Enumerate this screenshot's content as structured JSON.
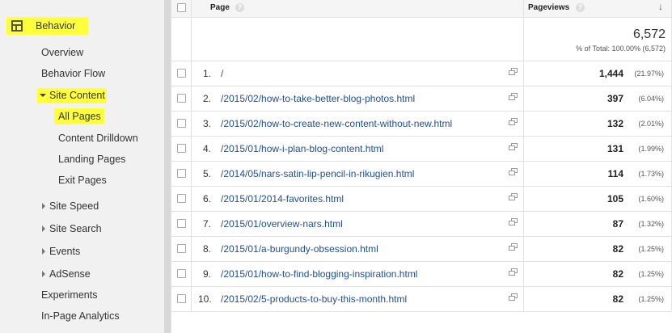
{
  "sidebar": {
    "behavior": "Behavior",
    "overview": "Overview",
    "behavior_flow": "Behavior Flow",
    "site_content": "Site Content",
    "all_pages": "All Pages",
    "content_drilldown": "Content Drilldown",
    "landing_pages": "Landing Pages",
    "exit_pages": "Exit Pages",
    "site_speed": "Site Speed",
    "site_search": "Site Search",
    "events": "Events",
    "adsense": "AdSense",
    "experiments": "Experiments",
    "in_page_analytics": "In-Page Analytics"
  },
  "colors": {
    "highlight": "#ffff3b",
    "link": "#1f4e9c"
  },
  "table": {
    "columns": {
      "page": "Page",
      "pageviews": "Pageviews"
    },
    "help_glyph": "?",
    "sort_glyph": "↓",
    "total": {
      "value": "6,572",
      "subtext": "% of Total: 100.00% (6,572)"
    },
    "rows": [
      {
        "rank": "1.",
        "page": "/",
        "pageviews": "1,444",
        "pct": "(21.97%)"
      },
      {
        "rank": "2.",
        "page": "/2015/02/how-to-take-better-blog-photos.html",
        "pageviews": "397",
        "pct": "(6.04%)"
      },
      {
        "rank": "3.",
        "page": "/2015/02/how-to-create-new-content-without-new.html",
        "pageviews": "132",
        "pct": "(2.01%)"
      },
      {
        "rank": "4.",
        "page": "/2015/01/how-i-plan-blog-content.html",
        "pageviews": "131",
        "pct": "(1.99%)"
      },
      {
        "rank": "5.",
        "page": "/2014/05/nars-satin-lip-pencil-in-rikugien.html",
        "pageviews": "114",
        "pct": "(1.73%)"
      },
      {
        "rank": "6.",
        "page": "/2015/01/2014-favorites.html",
        "pageviews": "105",
        "pct": "(1.60%)"
      },
      {
        "rank": "7.",
        "page": "/2015/01/overview-nars.html",
        "pageviews": "87",
        "pct": "(1.32%)"
      },
      {
        "rank": "8.",
        "page": "/2015/01/a-burgundy-obsession.html",
        "pageviews": "82",
        "pct": "(1.25%)"
      },
      {
        "rank": "9.",
        "page": "/2015/01/how-to-find-blogging-inspiration.html",
        "pageviews": "82",
        "pct": "(1.25%)"
      },
      {
        "rank": "10.",
        "page": "/2015/02/5-products-to-buy-this-month.html",
        "pageviews": "82",
        "pct": "(1.25%)"
      }
    ]
  }
}
